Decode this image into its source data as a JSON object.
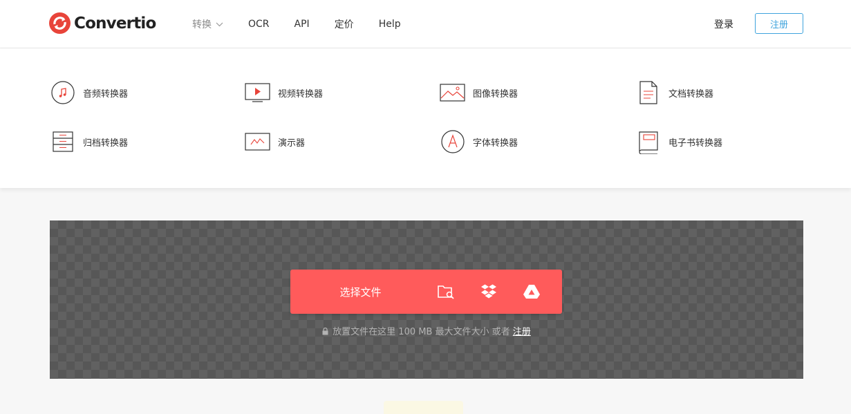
{
  "brand": {
    "name": "Convertio",
    "color": "#e8443a"
  },
  "nav": {
    "items": [
      {
        "label": "转换",
        "has_dropdown": true,
        "active": true
      },
      {
        "label": "OCR"
      },
      {
        "label": "API"
      },
      {
        "label": "定价"
      },
      {
        "label": "Help"
      }
    ]
  },
  "auth": {
    "login_label": "登录",
    "signup_label": "注册"
  },
  "converters": [
    {
      "label": "音频转换器",
      "icon": "music-note-icon"
    },
    {
      "label": "视频转换器",
      "icon": "video-play-icon"
    },
    {
      "label": "图像转换器",
      "icon": "image-icon"
    },
    {
      "label": "文档转换器",
      "icon": "document-icon"
    },
    {
      "label": "归档转换器",
      "icon": "archive-icon"
    },
    {
      "label": "演示器",
      "icon": "presentation-icon"
    },
    {
      "label": "字体转换器",
      "icon": "font-icon"
    },
    {
      "label": "电子书转换器",
      "icon": "ebook-icon"
    }
  ],
  "upload": {
    "choose_label": "选择文件",
    "sources": [
      "folder-search-icon",
      "dropbox-icon",
      "google-drive-icon"
    ],
    "hint_text": "放置文件在这里 100 MB 最大文件大小 或者",
    "hint_link": "注册"
  },
  "colors": {
    "accent": "#ff5b5b",
    "link_blue": "#3ea3dd",
    "dropzone_bg": "#616161"
  }
}
